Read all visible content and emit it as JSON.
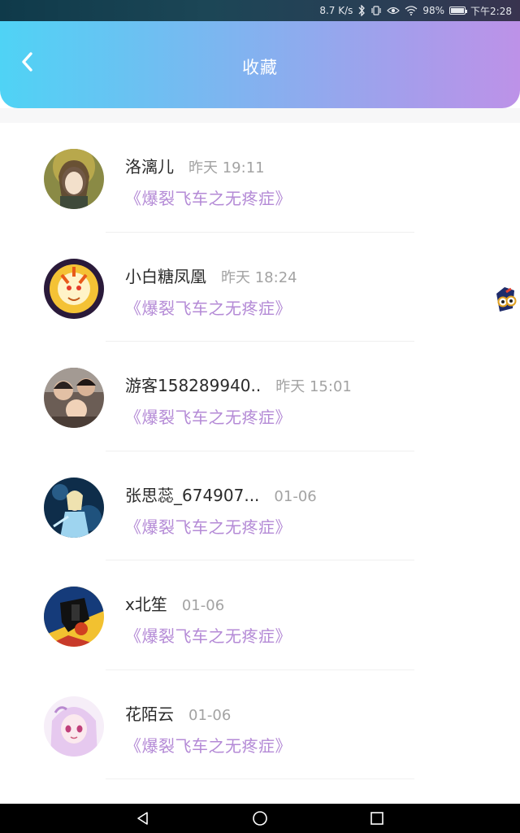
{
  "status_bar": {
    "speed": "8.7 K/s",
    "battery": "98%",
    "battery_level": 0.98,
    "time": "下午2:28",
    "icons": [
      "bluetooth-icon",
      "vibrate-icon",
      "eye-icon",
      "wifi-icon",
      "battery-icon"
    ]
  },
  "header": {
    "title": "收藏",
    "back_icon": "chevron-left-icon",
    "gradient": [
      "#4fd3f5",
      "#bd92e8"
    ]
  },
  "favorites": [
    {
      "name": "洛漓儿",
      "time": "昨天 19:11",
      "link": "《爆裂飞车之无疼症》"
    },
    {
      "name": "小白糖凤凰",
      "time": "昨天 18:24",
      "link": "《爆裂飞车之无疼症》"
    },
    {
      "name": "游客158289940..",
      "time": "昨天 15:01",
      "link": "《爆裂飞车之无疼症》"
    },
    {
      "name": "张思蕊_674907...",
      "time": "01-06",
      "link": "《爆裂飞车之无疼症》"
    },
    {
      "name": "x北笙",
      "time": "01-06",
      "link": "《爆裂飞车之无疼症》"
    },
    {
      "name": "花陌云",
      "time": "01-06",
      "link": "《爆裂飞车之无疼症》"
    }
  ],
  "colors": {
    "link": "#b48ad6",
    "name": "#2b2b2b",
    "time": "#a3a3a3"
  },
  "nav": [
    "back-triangle-icon",
    "home-circle-icon",
    "recents-square-icon"
  ]
}
